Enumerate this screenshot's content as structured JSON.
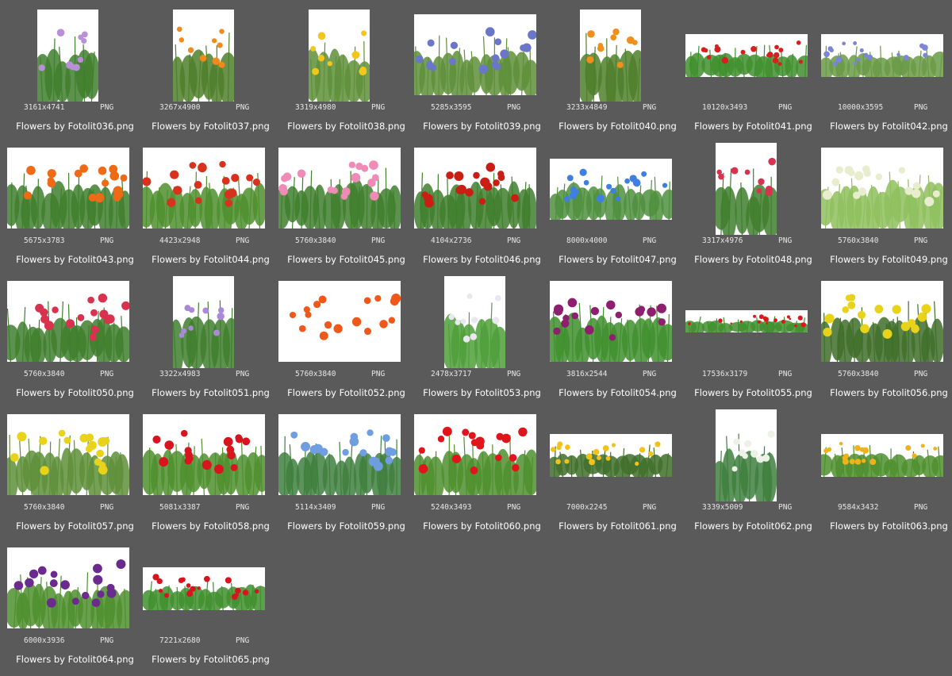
{
  "files": [
    {
      "name": "Flowers by Fotolit036.png",
      "dimensions": "3161x4741",
      "format": "PNG",
      "flower_color": "#b98fd6",
      "foliage": "#3f7f2e",
      "orientation": "portrait"
    },
    {
      "name": "Flowers by Fotolit037.png",
      "dimensions": "3267x4900",
      "format": "PNG",
      "flower_color": "#f08a1c",
      "foliage": "#4f7f2a",
      "orientation": "portrait"
    },
    {
      "name": "Flowers by Fotolit038.png",
      "dimensions": "3319x4980",
      "format": "PNG",
      "flower_color": "#f2c61a",
      "foliage": "#5f8f3a",
      "orientation": "portrait"
    },
    {
      "name": "Flowers by Fotolit039.png",
      "dimensions": "5285x3595",
      "format": "PNG",
      "flower_color": "#6a76c8",
      "foliage": "#5f8f3a",
      "orientation": "landscape"
    },
    {
      "name": "Flowers by Fotolit040.png",
      "dimensions": "3233x4849",
      "format": "PNG",
      "flower_color": "#f08f1a",
      "foliage": "#4f7f2a",
      "orientation": "portrait"
    },
    {
      "name": "Flowers by Fotolit041.png",
      "dimensions": "10120x3493",
      "format": "PNG",
      "flower_color": "#d81e1e",
      "foliage": "#3f8f2e",
      "orientation": "panorama"
    },
    {
      "name": "Flowers by Fotolit042.png",
      "dimensions": "10000x3595",
      "format": "PNG",
      "flower_color": "#7b86d6",
      "foliage": "#6a9a46",
      "orientation": "panorama"
    },
    {
      "name": "Flowers by Fotolit043.png",
      "dimensions": "5675x3783",
      "format": "PNG",
      "flower_color": "#ee6a14",
      "foliage": "#3f7f2e",
      "orientation": "landscape"
    },
    {
      "name": "Flowers by Fotolit044.png",
      "dimensions": "4423x2948",
      "format": "PNG",
      "flower_color": "#d8321e",
      "foliage": "#4f8f2e",
      "orientation": "landscape"
    },
    {
      "name": "Flowers by Fotolit045.png",
      "dimensions": "5760x3840",
      "format": "PNG",
      "flower_color": "#f08ab6",
      "foliage": "#3f7f2e",
      "orientation": "landscape"
    },
    {
      "name": "Flowers by Fotolit046.png",
      "dimensions": "4104x2736",
      "format": "PNG",
      "flower_color": "#c81e14",
      "foliage": "#3f7f2e",
      "orientation": "landscape"
    },
    {
      "name": "Flowers by Fotolit047.png",
      "dimensions": "8000x4000",
      "format": "PNG",
      "flower_color": "#3f7fe0",
      "foliage": "#4f8f3e",
      "orientation": "wide"
    },
    {
      "name": "Flowers by Fotolit048.png",
      "dimensions": "3317x4976",
      "format": "PNG",
      "flower_color": "#d8324e",
      "foliage": "#3f7f2e",
      "orientation": "portrait"
    },
    {
      "name": "Flowers by Fotolit049.png",
      "dimensions": "5760x3840",
      "format": "PNG",
      "flower_color": "#e8eecd",
      "foliage": "#8fbf5e",
      "orientation": "landscape"
    },
    {
      "name": "Flowers by Fotolit050.png",
      "dimensions": "5760x3840",
      "format": "PNG",
      "flower_color": "#d8324e",
      "foliage": "#3f7f2e",
      "orientation": "landscape"
    },
    {
      "name": "Flowers by Fotolit051.png",
      "dimensions": "3322x4983",
      "format": "PNG",
      "flower_color": "#a88ad8",
      "foliage": "#3f7f2e",
      "orientation": "portrait"
    },
    {
      "name": "Flowers by Fotolit052.png",
      "dimensions": "5760x3840",
      "format": "PNG",
      "flower_color": "#f0581a",
      "foliage": "#ffffff",
      "orientation": "landscape"
    },
    {
      "name": "Flowers by Fotolit053.png",
      "dimensions": "2478x3717",
      "format": "PNG",
      "flower_color": "#e8e8f0",
      "foliage": "#4f9f3a",
      "orientation": "portrait"
    },
    {
      "name": "Flowers by Fotolit054.png",
      "dimensions": "3816x2544",
      "format": "PNG",
      "flower_color": "#8e1e6e",
      "foliage": "#3f8f2e",
      "orientation": "landscape"
    },
    {
      "name": "Flowers by Fotolit055.png",
      "dimensions": "17536x3179",
      "format": "PNG",
      "flower_color": "#e0141a",
      "foliage": "#3f8f2e",
      "orientation": "strip"
    },
    {
      "name": "Flowers by Fotolit056.png",
      "dimensions": "5760x3840",
      "format": "PNG",
      "flower_color": "#e8d21a",
      "foliage": "#3f6f2a",
      "orientation": "landscape"
    },
    {
      "name": "Flowers by Fotolit057.png",
      "dimensions": "5760x3840",
      "format": "PNG",
      "flower_color": "#e8d21a",
      "foliage": "#5f8f3a",
      "orientation": "landscape"
    },
    {
      "name": "Flowers by Fotolit058.png",
      "dimensions": "5081x3387",
      "format": "PNG",
      "flower_color": "#d8141e",
      "foliage": "#4f8f2e",
      "orientation": "landscape"
    },
    {
      "name": "Flowers by Fotolit059.png",
      "dimensions": "5114x3409",
      "format": "PNG",
      "flower_color": "#6f9ee0",
      "foliage": "#3f7f3e",
      "orientation": "landscape"
    },
    {
      "name": "Flowers by Fotolit060.png",
      "dimensions": "5240x3493",
      "format": "PNG",
      "flower_color": "#e0141a",
      "foliage": "#4f8f2e",
      "orientation": "landscape"
    },
    {
      "name": "Flowers by Fotolit061.png",
      "dimensions": "7000x2245",
      "format": "PNG",
      "flower_color": "#f0c21a",
      "foliage": "#3f6f2a",
      "orientation": "panorama"
    },
    {
      "name": "Flowers by Fotolit062.png",
      "dimensions": "3339x5009",
      "format": "PNG",
      "flower_color": "#eef2e6",
      "foliage": "#3f7f3e",
      "orientation": "portrait"
    },
    {
      "name": "Flowers by Fotolit063.png",
      "dimensions": "9584x3432",
      "format": "PNG",
      "flower_color": "#f0b21a",
      "foliage": "#4f8f2e",
      "orientation": "panorama"
    },
    {
      "name": "Flowers by Fotolit064.png",
      "dimensions": "6000x3936",
      "format": "PNG",
      "flower_color": "#6a2a8e",
      "foliage": "#4f8f2e",
      "orientation": "landscape"
    },
    {
      "name": "Flowers by Fotolit065.png",
      "dimensions": "7221x2680",
      "format": "PNG",
      "flower_color": "#d8141e",
      "foliage": "#3f8f2e",
      "orientation": "panorama"
    }
  ]
}
